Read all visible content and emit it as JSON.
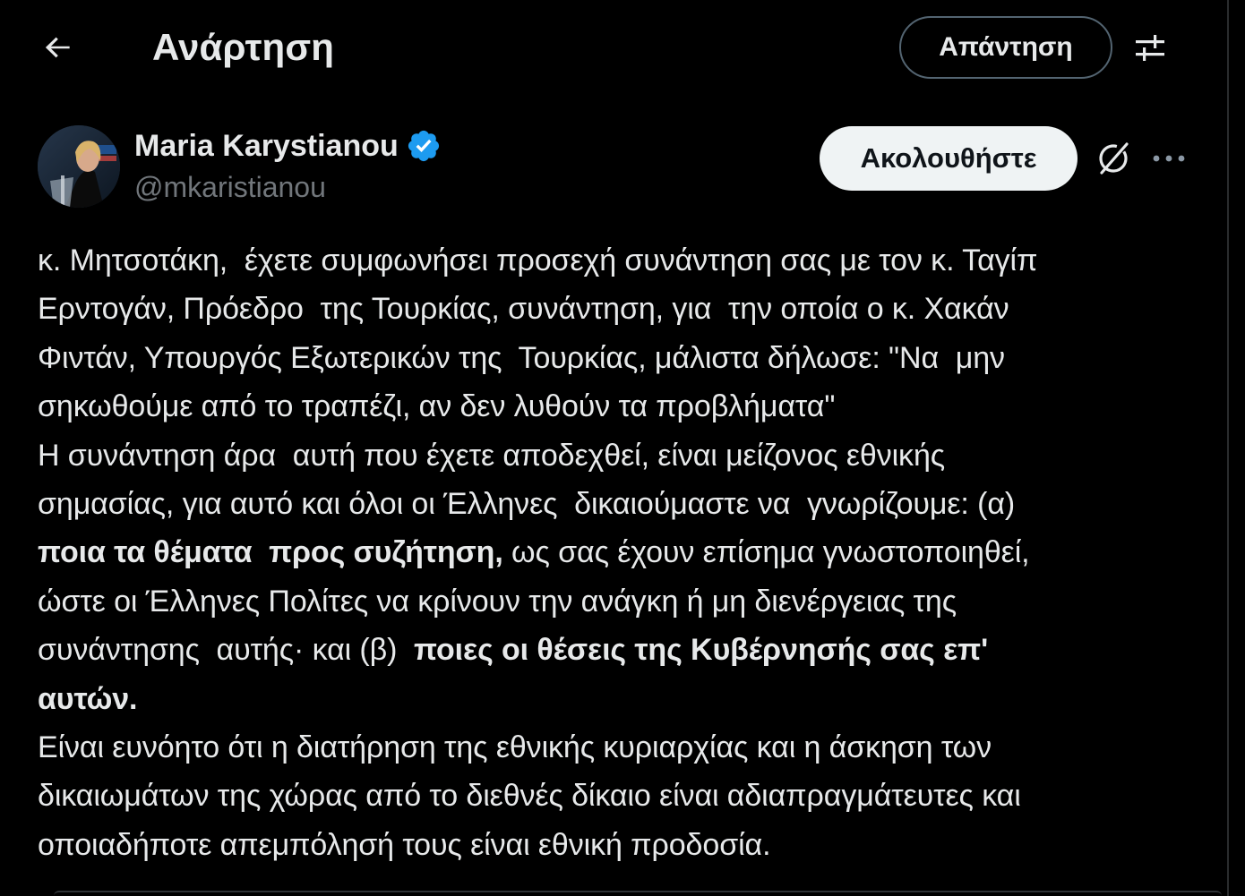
{
  "header": {
    "back_icon": "arrow-left-icon",
    "title": "Ανάρτηση",
    "reply_label": "Απάντηση",
    "settings_icon": "sliders-icon"
  },
  "author": {
    "name": "Maria Karystianou",
    "handle": "@mkaristianou",
    "verified_icon": "verified-badge-icon",
    "verified_color": "#1d9bf0",
    "follow_label": "Ακολουθήστε",
    "grok_icon": "grok-icon",
    "more_icon": "more-dots-icon"
  },
  "tweet": {
    "lines": [
      [
        {
          "t": "κ. Μητσοτάκη,  έχετε συμφωνήσει προσεχή συνάντηση σας με τον κ. Ταγίπ",
          "b": false
        }
      ],
      [
        {
          "t": "Ερντογάν, Πρόεδρο  της Τουρκίας, συνάντηση, για  την οποία ο κ. Χακάν",
          "b": false
        }
      ],
      [
        {
          "t": "Φιντάν, Υπουργός Εξωτερικών της  Τουρκίας, μάλιστα δήλωσε: \"Να  μην",
          "b": false
        }
      ],
      [
        {
          "t": "σηκωθούμε από το τραπέζι, αν δεν λυθούν τα προβλήματα\"",
          "b": false
        }
      ],
      [
        {
          "t": "Η συνάντηση άρα  αυτή που έχετε αποδεχθεί, είναι μείζονος εθνικής",
          "b": false
        }
      ],
      [
        {
          "t": "σημασίας, για αυτό και όλοι οι Έλληνες  δικαιούμαστε να  γνωρίζουμε: (α)",
          "b": false
        }
      ],
      [
        {
          "t": "ποια τα θέματα  προς συζήτηση,",
          "b": true
        },
        {
          "t": " ως σας έχουν επίσημα γνωστοποιηθεί,",
          "b": false
        }
      ],
      [
        {
          "t": "ώστε οι Έλληνες Πολίτες να κρίνουν την ανάγκη ή μη διενέργειας της",
          "b": false
        }
      ],
      [
        {
          "t": "συνάντησης  αυτής· και (β)  ",
          "b": false
        },
        {
          "t": "ποιες οι θέσεις της Κυβέρνησής σας επ'",
          "b": true
        }
      ],
      [
        {
          "t": "αυτών.",
          "b": true
        }
      ],
      [
        {
          "t": "Είναι ευνόητο ότι η διατήρηση της εθνικής κυριαρχίας και η άσκηση των",
          "b": false
        }
      ],
      [
        {
          "t": "δικαιωμάτων της χώρας από το διεθνές δίκαιο είναι αδιαπραγμάτευτες και",
          "b": false
        }
      ],
      [
        {
          "t": "οποιαδήποτε απεμπόλησή τους είναι εθνική προδοσία.",
          "b": false
        }
      ]
    ]
  },
  "colors": {
    "background": "#000000",
    "text": "#e7e9ea",
    "muted": "#71767b",
    "border": "#536471",
    "follow_bg": "#eff3f4"
  }
}
